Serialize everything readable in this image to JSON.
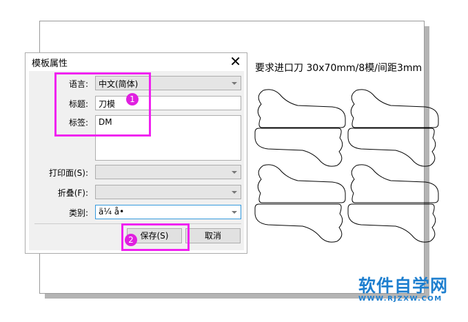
{
  "dialog": {
    "title": "模板属性",
    "close_icon": "close-icon",
    "fields": {
      "language_label": "语言:",
      "language_value": "中文(简体)",
      "title_label": "标题:",
      "title_value": "刀模",
      "tags_label": "标签:",
      "tags_value": "DM",
      "print_side_label": "打印面(S):",
      "fold_label": "折叠(F):",
      "category_label": "类别:",
      "category_value": "ä¼ å•"
    },
    "buttons": {
      "save": "保存(S)",
      "cancel": "取消"
    }
  },
  "annotations": {
    "badge1": "1",
    "badge2": "2",
    "color": "#f020f0"
  },
  "canvas": {
    "note": "要求进口刀 30x70mm/8模/间距3mm"
  },
  "watermark": {
    "title": "软件自学网",
    "url": "WWW.RJZXW.COM"
  }
}
